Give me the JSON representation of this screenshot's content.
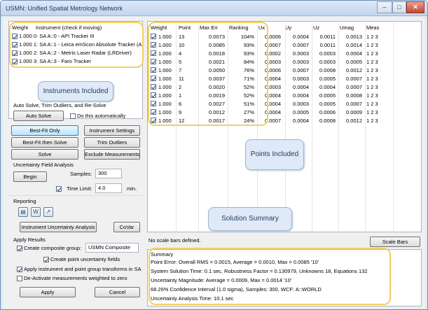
{
  "window": {
    "title": "USMN: Unified Spatial Metrology Network",
    "minimize": "–",
    "maximize": "□",
    "close": "✕"
  },
  "instruments": {
    "headers": {
      "weight": "Weight",
      "instrument": "Instrument (check if moving)"
    },
    "rows": [
      {
        "weight": "1.000",
        "name": "0: SA A::0 - API Tracker III"
      },
      {
        "weight": "1.000",
        "name": "1: SA A::1 - Leica emScon Absolute Tracker (A"
      },
      {
        "weight": "1.000",
        "name": "2: SA A::2 - Metris Laser Radar (LRDriver)"
      },
      {
        "weight": "1.000",
        "name": "3: SA A::3 - Faro Tracker"
      }
    ],
    "callout": "Instruments Included"
  },
  "auto_solve": {
    "heading": "Auto Solve, Trim Outliers, and Re-Solve",
    "button": "Auto Solve",
    "checkbox": "Do this automatically"
  },
  "actions": {
    "best_fit_only": "Best-Fit Only",
    "instrument_settings": "Instrument Settings",
    "best_fit_then_solve": "Best-Fit then Solve",
    "trim_outliers": "Trim Outliers",
    "solve": "Solve",
    "exclude_measurements": "Exclude Measurements"
  },
  "uncertainty": {
    "heading": "Uncertainty Field Analysis",
    "begin": "Begin",
    "samples_label": "Samples:",
    "samples_value": "300",
    "time_limit_label": "Time Limit:",
    "time_limit_value": "4.0",
    "time_unit": "min."
  },
  "reporting": {
    "heading": "Reporting",
    "instrument_uncertainty": "Instrument Uncertainty Analysis",
    "covar": "CoVar"
  },
  "apply": {
    "heading": "Apply Results",
    "create_group_label": "Create composite group:",
    "create_group_value": "USMN Composite",
    "point_uncertainty": "Create point uncertainty fields",
    "apply_transforms": "Apply instrument and point group transforms in SA",
    "deactivate": "De-Activate measurements weighted to zero",
    "apply_btn": "Apply",
    "cancel_btn": "Cancel"
  },
  "points": {
    "headers": [
      "Weight",
      "Point",
      "Max Err",
      "Ranking",
      "Ux",
      "Uy",
      "Uz",
      "Umag",
      "Meas"
    ],
    "rows": [
      [
        "1.000",
        "13",
        "0.0073",
        "104%",
        "0.0006",
        "0.0004",
        "0.0011",
        "0.0013",
        "1 2 3"
      ],
      [
        "1.000",
        "10",
        "0.0085",
        "93%",
        "0.0007",
        "0.0007",
        "0.0011",
        "0.0014",
        "1 2 3"
      ],
      [
        "1.000",
        "4",
        "0.0018",
        "93%",
        "0.0002",
        "0.0003",
        "0.0003",
        "0.0004",
        "1 2 3"
      ],
      [
        "1.000",
        "5",
        "0.0021",
        "84%",
        "0.0003",
        "0.0003",
        "0.0003",
        "0.0005",
        "1 2 3"
      ],
      [
        "1.000",
        "7",
        "0.0050",
        "76%",
        "0.0006",
        "0.0007",
        "0.0008",
        "0.0012",
        "1 2 3"
      ],
      [
        "1.000",
        "11",
        "0.0037",
        "71%",
        "0.0004",
        "0.0003",
        "0.0005",
        "0.0007",
        "1 2 3"
      ],
      [
        "1.000",
        "2",
        "0.0020",
        "52%",
        "0.0003",
        "0.0004",
        "0.0004",
        "0.0007",
        "1 2 3"
      ],
      [
        "1.000",
        "1",
        "0.0019",
        "52%",
        "0.0004",
        "0.0004",
        "0.0005",
        "0.0008",
        "1 2 3"
      ],
      [
        "1.000",
        "6",
        "0.0027",
        "51%",
        "0.0004",
        "0.0003",
        "0.0005",
        "0.0007",
        "1 2 3"
      ],
      [
        "1.000",
        "9",
        "0.0012",
        "27%",
        "0.0004",
        "0.0005",
        "0.0006",
        "0.0009",
        "1 2 3"
      ],
      [
        "1.000",
        "12",
        "0.0017",
        "24%",
        "0.0007",
        "0.0004",
        "0.0008",
        "0.0012",
        "1 2 3"
      ]
    ],
    "callout": "Points Included"
  },
  "scale_bars": {
    "label": "No scale bars defined.",
    "button": "Scale Bars"
  },
  "summary": {
    "callout": "Solution Summary",
    "heading": "Summary",
    "lines": [
      "Point Error: Overall RMS = 0.0015, Average = 0.0010, Max = 0.0085 '10'",
      "System Solution Time: 0.1 sec,  Robustness Factor = 0.130979,  Unknowns 18, Equations 132",
      "Uncertainty Magnitude:  Average = 0.0009, Max = 0.0014 '10'",
      "68.26% Confidence Interval (1.0 sigma), Samples: 300, WCF: A::WORLD",
      "Uncertainty Analysis Time: 10.1 sec"
    ]
  }
}
